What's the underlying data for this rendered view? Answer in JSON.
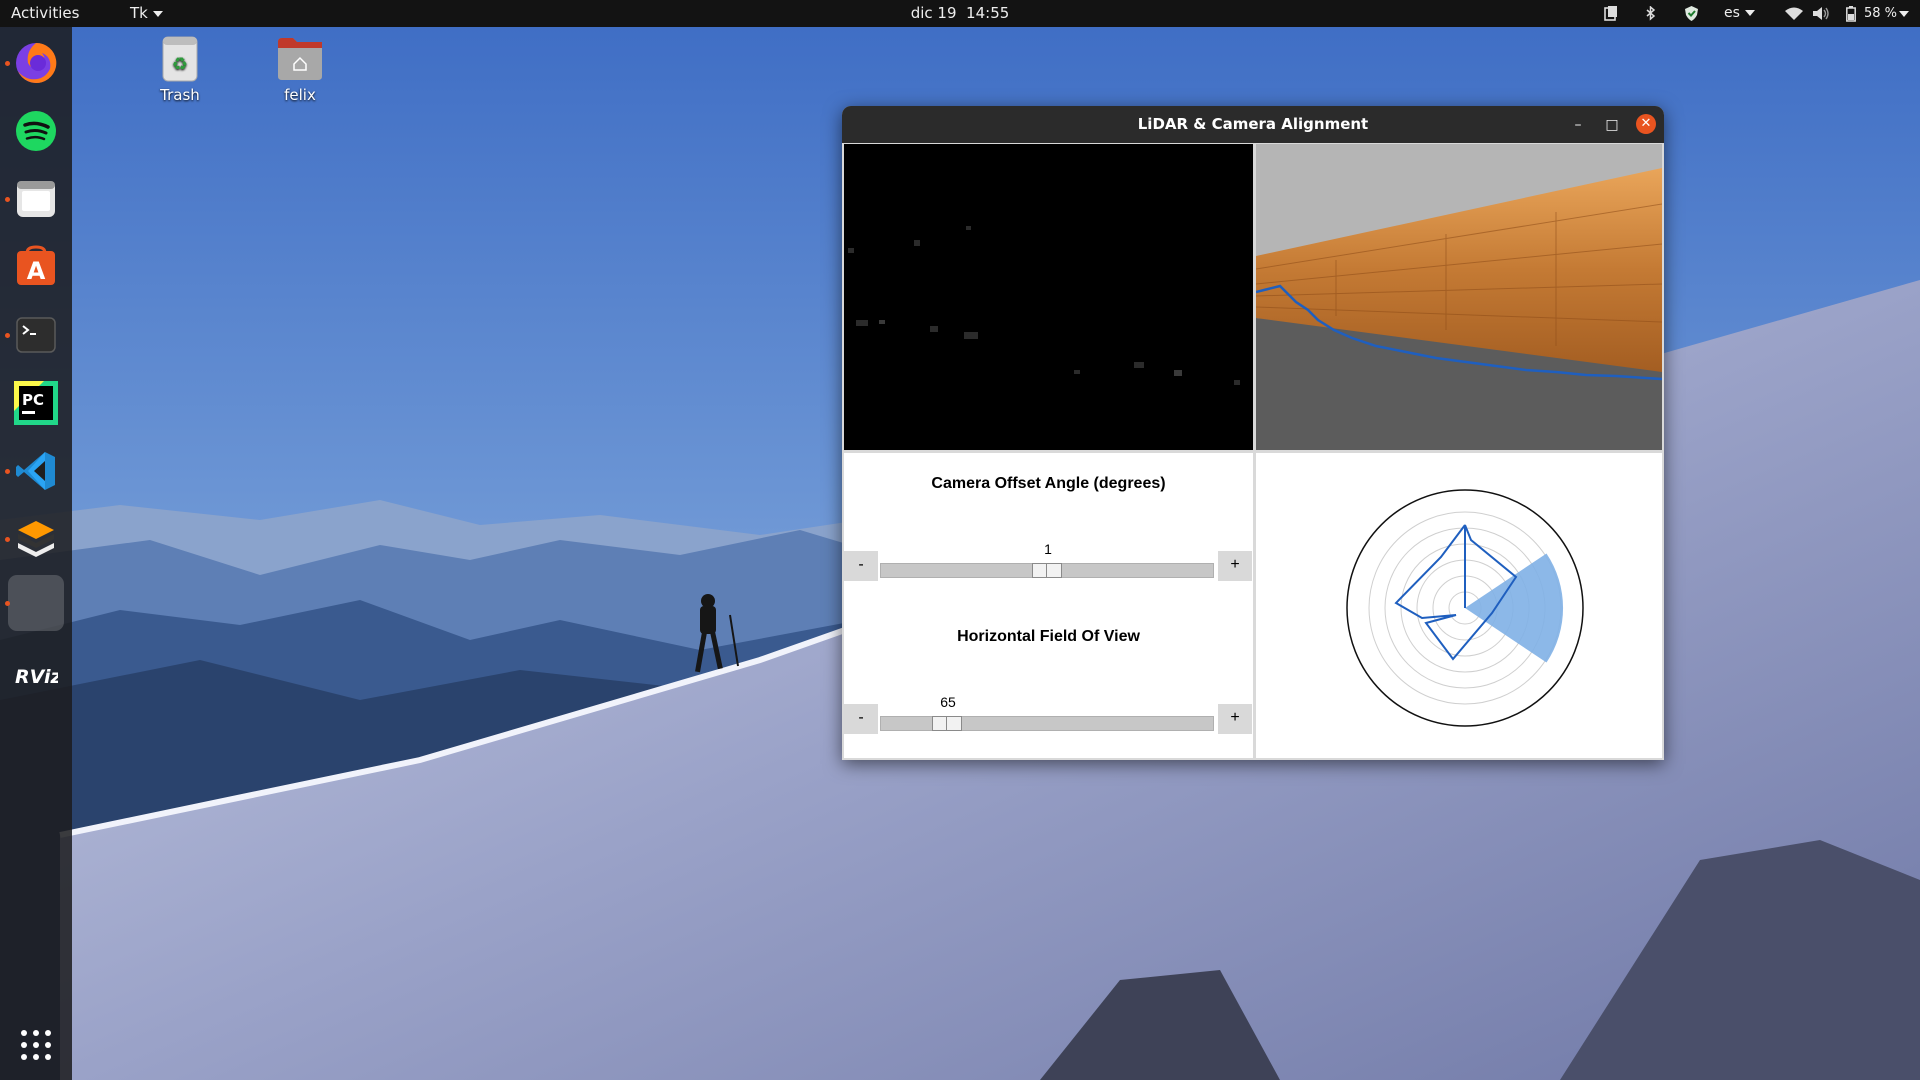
{
  "topbar": {
    "activities": "Activities",
    "app_menu": "Tk",
    "date": "dic 19",
    "time": "14:55",
    "language": "es",
    "battery": "58 %"
  },
  "dock": {
    "items": [
      {
        "name": "firefox",
        "icon": "firefox-icon",
        "running": true
      },
      {
        "name": "spotify",
        "icon": "spotify-icon",
        "running": false
      },
      {
        "name": "files",
        "icon": "folder-icon",
        "running": true
      },
      {
        "name": "ubuntu-software",
        "icon": "software-center-icon",
        "running": false
      },
      {
        "name": "terminal",
        "icon": "terminal-icon",
        "running": true
      },
      {
        "name": "pycharm",
        "icon": "pycharm-icon",
        "running": false
      },
      {
        "name": "vscode",
        "icon": "vscode-icon",
        "running": true
      },
      {
        "name": "sublime-merge",
        "icon": "sublime-icon",
        "running": true
      },
      {
        "name": "tk-window",
        "icon": "generic-app-icon",
        "running": true
      },
      {
        "name": "rviz",
        "icon": "rviz-icon",
        "running": false
      }
    ],
    "show_apps_icon": "app-grid-icon"
  },
  "desktop": {
    "icons": [
      {
        "label": "Trash",
        "icon": "trash-icon"
      },
      {
        "label": "felix",
        "icon": "home-folder-icon"
      }
    ]
  },
  "window": {
    "title": "LiDAR & Camera Alignment",
    "minimize_symbol": "–",
    "maximize_symbol": "□",
    "close_symbol": "✕"
  },
  "controls": {
    "offset_angle": {
      "title": "Camera Offset Angle (degrees)",
      "value": "1",
      "position_fraction": 0.5,
      "minus": "-",
      "plus": "+"
    },
    "fov": {
      "title": "Horizontal Field Of View",
      "value": "65",
      "position_fraction": 0.2,
      "minus": "-",
      "plus": "+"
    }
  },
  "colors": {
    "accent": "#e95420",
    "lidar_line": "#1f5fbf",
    "fov_wedge": "#7fb0e6"
  }
}
